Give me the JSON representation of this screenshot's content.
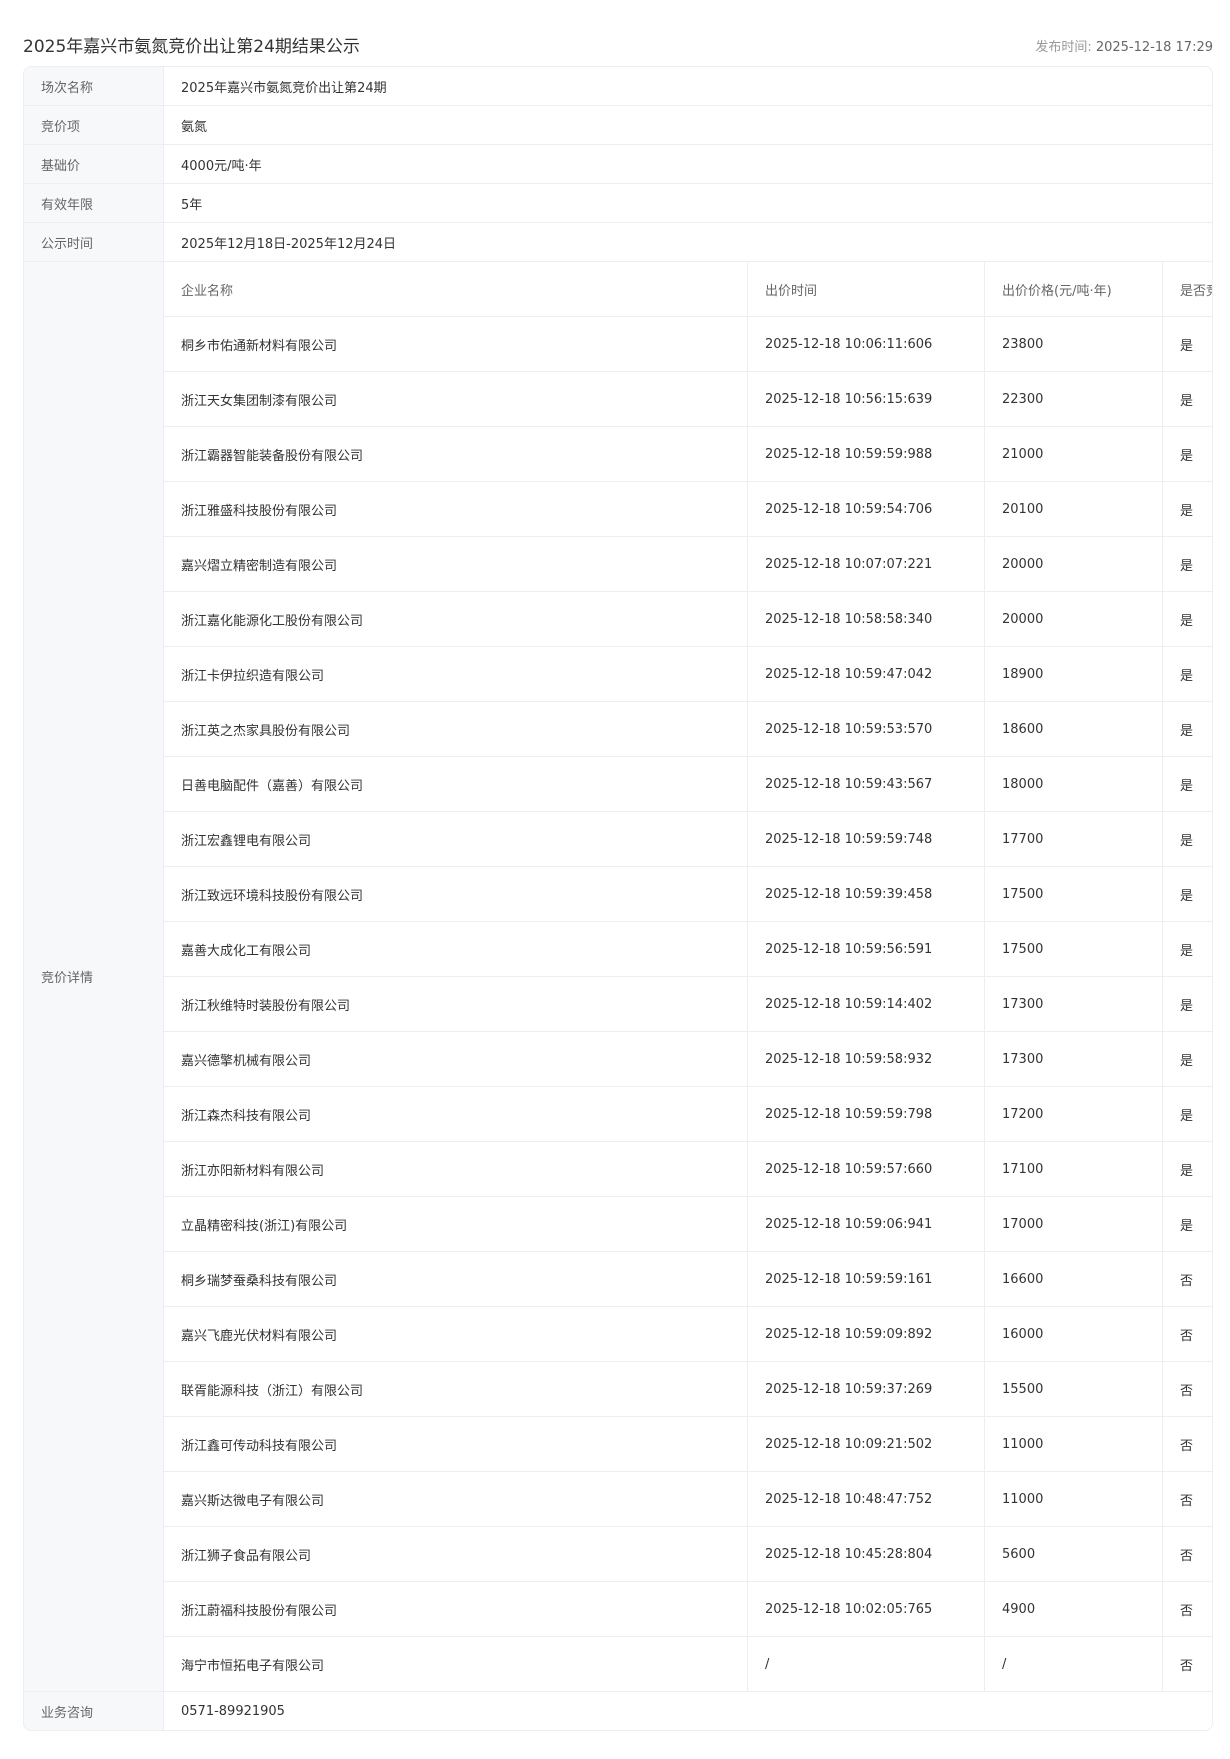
{
  "header": {
    "title": "2025年嘉兴市氨氮竞价出让第24期结果公示",
    "publish_label": "发布时间: ",
    "publish_time": "2025-12-18 17:29"
  },
  "info": {
    "session_label": "场次名称",
    "session_value": "2025年嘉兴市氨氮竞价出让第24期",
    "item_label": "竞价项",
    "item_value": "氨氮",
    "base_price_label": "基础价",
    "base_price_value": "4000元/吨·年",
    "validity_label": "有效年限",
    "validity_value": "5年",
    "notice_period_label": "公示时间",
    "notice_period_value": "2025年12月18日-2025年12月24日",
    "details_label": "竞价详情",
    "contact_label": "业务咨询",
    "contact_value": "0571-89921905"
  },
  "bids": {
    "columns": [
      "企业名称",
      "出价时间",
      "出价价格(元/吨·年)",
      "是否竞得"
    ],
    "rows": [
      [
        "桐乡市佑通新材料有限公司",
        "2025-12-18 10:06:11:606",
        "23800",
        "是"
      ],
      [
        "浙江天女集团制漆有限公司",
        "2025-12-18 10:56:15:639",
        "22300",
        "是"
      ],
      [
        "浙江霸器智能装备股份有限公司",
        "2025-12-18 10:59:59:988",
        "21000",
        "是"
      ],
      [
        "浙江雅盛科技股份有限公司",
        "2025-12-18 10:59:54:706",
        "20100",
        "是"
      ],
      [
        "嘉兴熠立精密制造有限公司",
        "2025-12-18 10:07:07:221",
        "20000",
        "是"
      ],
      [
        "浙江嘉化能源化工股份有限公司",
        "2025-12-18 10:58:58:340",
        "20000",
        "是"
      ],
      [
        "浙江卡伊拉织造有限公司",
        "2025-12-18 10:59:47:042",
        "18900",
        "是"
      ],
      [
        "浙江英之杰家具股份有限公司",
        "2025-12-18 10:59:53:570",
        "18600",
        "是"
      ],
      [
        "日善电脑配件（嘉善）有限公司",
        "2025-12-18 10:59:43:567",
        "18000",
        "是"
      ],
      [
        "浙江宏鑫锂电有限公司",
        "2025-12-18 10:59:59:748",
        "17700",
        "是"
      ],
      [
        "浙江致远环境科技股份有限公司",
        "2025-12-18 10:59:39:458",
        "17500",
        "是"
      ],
      [
        "嘉善大成化工有限公司",
        "2025-12-18 10:59:56:591",
        "17500",
        "是"
      ],
      [
        "浙江秋维特时装股份有限公司",
        "2025-12-18 10:59:14:402",
        "17300",
        "是"
      ],
      [
        "嘉兴德擎机械有限公司",
        "2025-12-18 10:59:58:932",
        "17300",
        "是"
      ],
      [
        "浙江森杰科技有限公司",
        "2025-12-18 10:59:59:798",
        "17200",
        "是"
      ],
      [
        "浙江亦阳新材料有限公司",
        "2025-12-18 10:59:57:660",
        "17100",
        "是"
      ],
      [
        "立晶精密科技(浙江)有限公司",
        "2025-12-18 10:59:06:941",
        "17000",
        "是"
      ],
      [
        "桐乡瑞梦蚕桑科技有限公司",
        "2025-12-18 10:59:59:161",
        "16600",
        "否"
      ],
      [
        "嘉兴飞鹿光伏材料有限公司",
        "2025-12-18 10:59:09:892",
        "16000",
        "否"
      ],
      [
        "联胥能源科技（浙江）有限公司",
        "2025-12-18 10:59:37:269",
        "15500",
        "否"
      ],
      [
        "浙江鑫可传动科技有限公司",
        "2025-12-18 10:09:21:502",
        "11000",
        "否"
      ],
      [
        "嘉兴斯达微电子有限公司",
        "2025-12-18 10:48:47:752",
        "11000",
        "否"
      ],
      [
        "浙江狮子食品有限公司",
        "2025-12-18 10:45:28:804",
        "5600",
        "否"
      ],
      [
        "浙江蔚福科技股份有限公司",
        "2025-12-18 10:02:05:765",
        "4900",
        "否"
      ],
      [
        "海宁市恒拓电子有限公司",
        "/",
        "/",
        "否"
      ]
    ]
  }
}
